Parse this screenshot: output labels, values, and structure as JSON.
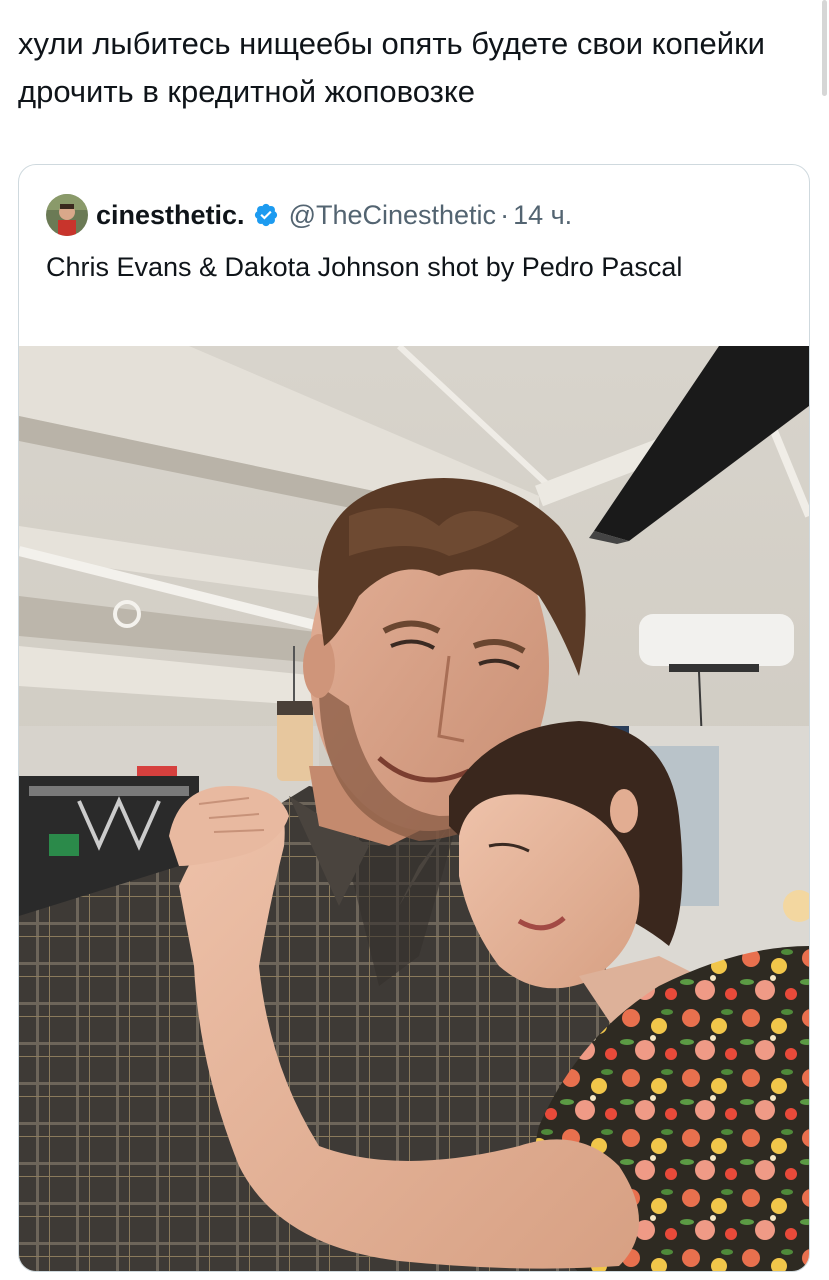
{
  "post": {
    "text": "хули лыбитесь нищеебы опять будете свои копейки дрочить в кредитной жоповозке"
  },
  "quoted_post": {
    "display_name": "cinesthetic.",
    "handle": "@TheCinesthetic",
    "separator": "·",
    "time": "14 ч.",
    "text": "Chris Evans & Dakota Johnson shot by Pedro Pascal",
    "avatar_icon": "profile-avatar",
    "verified_icon": "verified-badge-icon",
    "verified_color": "#1d9bf0"
  }
}
